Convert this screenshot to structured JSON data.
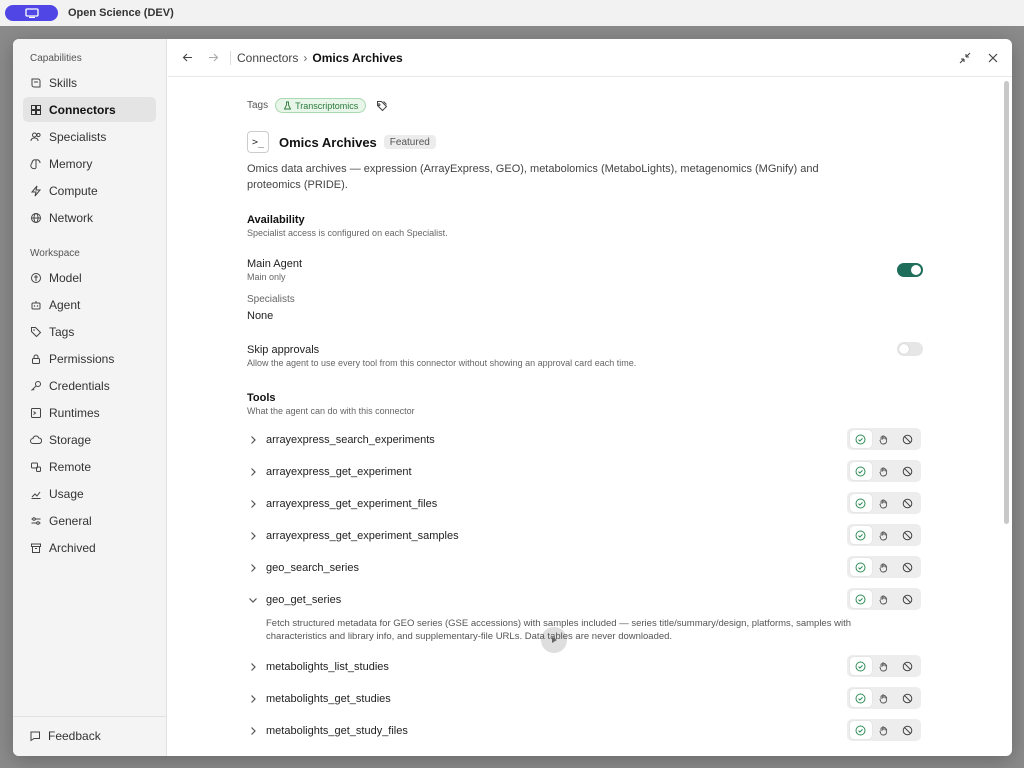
{
  "app": {
    "title": "Open Science (DEV)"
  },
  "sidebar": {
    "capabilities_label": "Capabilities",
    "workspace_label": "Workspace",
    "capabilities": [
      {
        "label": "Skills",
        "icon": "book-icon"
      },
      {
        "label": "Connectors",
        "icon": "grid-icon",
        "active": true
      },
      {
        "label": "Specialists",
        "icon": "users-icon"
      },
      {
        "label": "Memory",
        "icon": "brain-icon"
      },
      {
        "label": "Compute",
        "icon": "bolt-icon"
      },
      {
        "label": "Network",
        "icon": "globe-icon"
      }
    ],
    "workspace": [
      {
        "label": "Model",
        "icon": "model-icon"
      },
      {
        "label": "Agent",
        "icon": "robot-icon"
      },
      {
        "label": "Tags",
        "icon": "tag-icon"
      },
      {
        "label": "Permissions",
        "icon": "lock-icon"
      },
      {
        "label": "Credentials",
        "icon": "key-icon"
      },
      {
        "label": "Runtimes",
        "icon": "terminal-icon"
      },
      {
        "label": "Storage",
        "icon": "cloud-icon"
      },
      {
        "label": "Remote",
        "icon": "remote-icon"
      },
      {
        "label": "Usage",
        "icon": "chart-icon"
      },
      {
        "label": "General",
        "icon": "sliders-icon"
      },
      {
        "label": "Archived",
        "icon": "archive-icon"
      }
    ],
    "feedback_label": "Feedback"
  },
  "header": {
    "crumb_parent": "Connectors",
    "crumb_sep": "›",
    "crumb_current": "Omics Archives"
  },
  "connector": {
    "tags_label": "Tags",
    "tag": "Transcriptomics",
    "terminal_glyph": ">_",
    "title": "Omics Archives",
    "badge": "Featured",
    "description": "Omics data archives — expression (ArrayExpress, GEO), metabolomics (MetaboLights), metagenomics (MGnify) and proteomics (PRIDE)."
  },
  "availability": {
    "heading": "Availability",
    "subtitle": "Specialist access is configured on each Specialist.",
    "main_agent_label": "Main Agent",
    "main_agent_sub": "Main only",
    "main_agent_enabled": true,
    "specialists_label": "Specialists",
    "specialists_value": "None",
    "skip_label": "Skip approvals",
    "skip_sub": "Allow the agent to use every tool from this connector without showing an approval card each time.",
    "skip_enabled": false
  },
  "tools": {
    "heading": "Tools",
    "subtitle": "What the agent can do with this connector",
    "items": [
      {
        "name": "arrayexpress_search_experiments",
        "expanded": false
      },
      {
        "name": "arrayexpress_get_experiment",
        "expanded": false
      },
      {
        "name": "arrayexpress_get_experiment_files",
        "expanded": false
      },
      {
        "name": "arrayexpress_get_experiment_samples",
        "expanded": false
      },
      {
        "name": "geo_search_series",
        "expanded": false
      },
      {
        "name": "geo_get_series",
        "expanded": true,
        "description": "Fetch structured metadata for GEO series (GSE accessions) with samples included — series title/summary/design, platforms, samples with characteristics and library info, and supplementary-file URLs. Data tables are never downloaded."
      },
      {
        "name": "metabolights_list_studies",
        "expanded": false
      },
      {
        "name": "metabolights_get_studies",
        "expanded": false
      },
      {
        "name": "metabolights_get_study_files",
        "expanded": false
      }
    ]
  },
  "colors": {
    "accent": "#1f6e5b",
    "app_pill": "#4f46e5",
    "tag_green": "#2b7a3a"
  }
}
